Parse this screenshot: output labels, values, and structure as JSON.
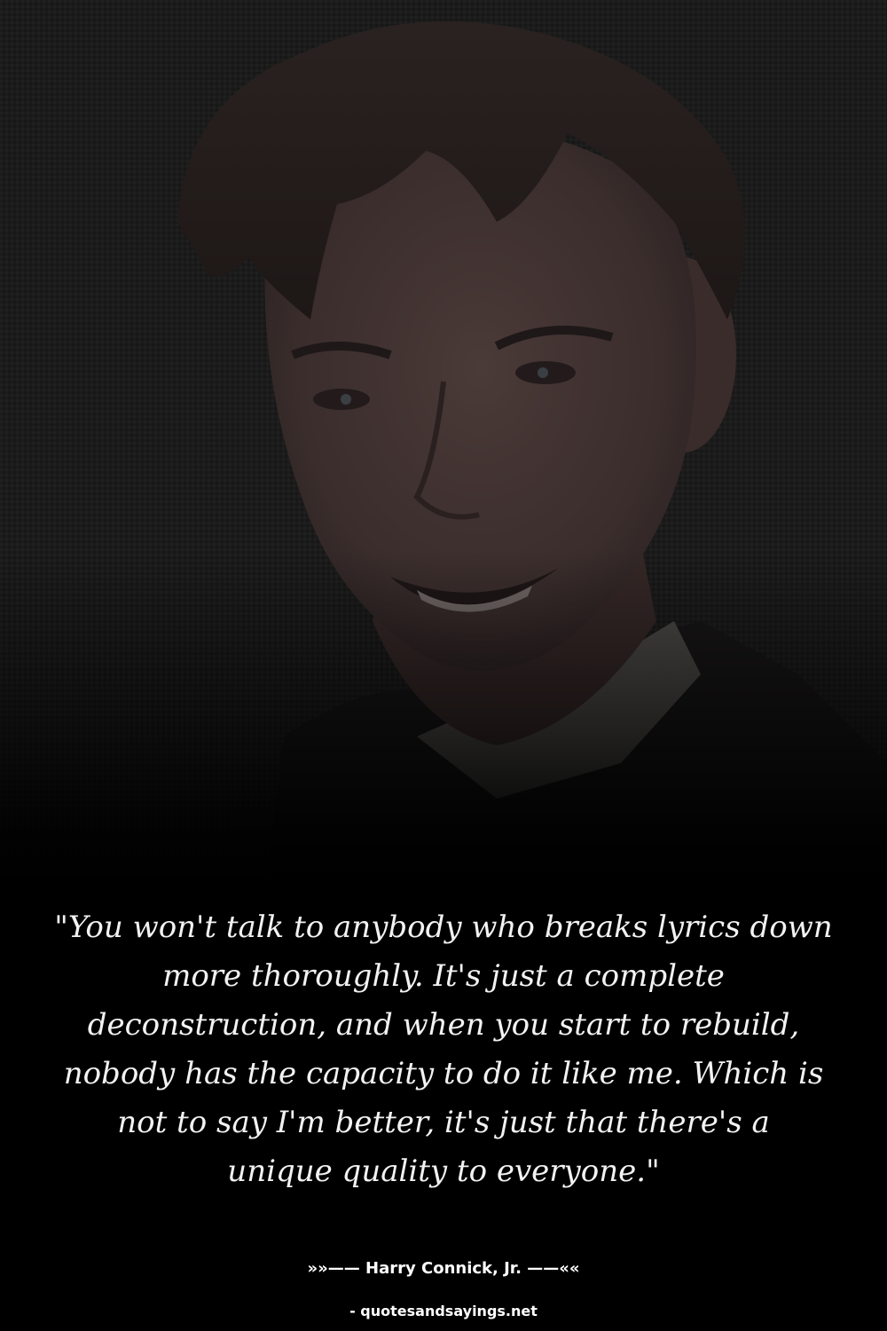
{
  "quote": {
    "lines": [
      "\"You won't talk to anybody who breaks lyrics down",
      "more thoroughly. It's just a complete",
      "deconstruction, and when you start to rebuild,",
      "nobody has the capacity to do it like me. Which is",
      "not to say I'm better, it's just that there's a",
      "unique quality to everyone.\""
    ]
  },
  "attribution": {
    "author_line": "»»—— Harry Connick, Jr. ——««"
  },
  "footer": {
    "site": "- quotesandsayings.net"
  },
  "colors": {
    "background": "#000000",
    "text": "#f2f2f2"
  }
}
